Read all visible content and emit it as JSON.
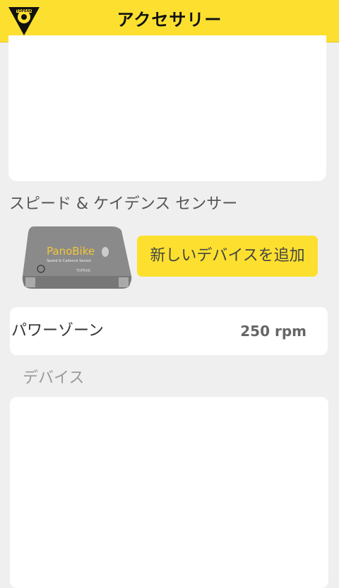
{
  "header": {
    "title": "アクセサリー",
    "logo_text": "TOPEAK",
    "logo_icon": "topeak-logo-icon"
  },
  "sensor_section": {
    "title": "スピード & ケイデンス センサー",
    "image": {
      "icon": "panobike-sensor-image",
      "brand": "PanoBike",
      "subtitle": "Speed & Cadence Sensor",
      "maker": "TOPEAK"
    },
    "add_button_label": "新しいデバイスを追加"
  },
  "power_zone": {
    "label": "パワーゾーン",
    "value": "250 rpm"
  },
  "devices": {
    "label": "デバイス"
  },
  "colors": {
    "accent": "#fde02f",
    "background": "#efefef",
    "card": "#ffffff"
  }
}
